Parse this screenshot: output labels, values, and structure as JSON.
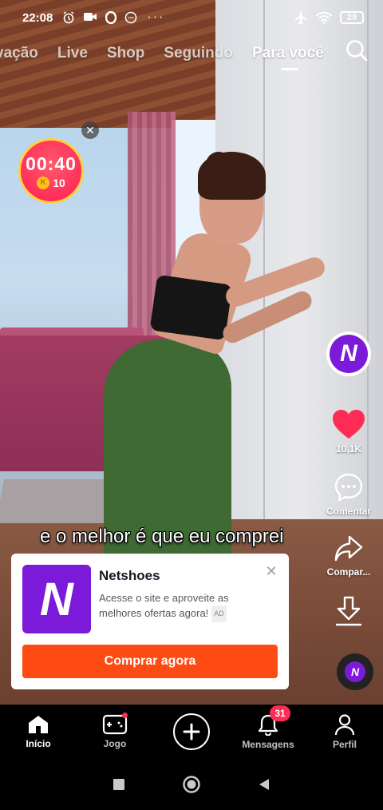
{
  "status_bar": {
    "time": "22:08",
    "battery": "29",
    "more": "···"
  },
  "top_tabs": [
    {
      "label": "vação",
      "active": false
    },
    {
      "label": "Live",
      "active": false
    },
    {
      "label": "Shop",
      "active": false
    },
    {
      "label": "Seguindo",
      "active": false
    },
    {
      "label": "Para você",
      "active": true
    }
  ],
  "timer": {
    "time": "00:40",
    "coins": "10",
    "coin_symbol": "K",
    "close": "✕"
  },
  "rail": {
    "creator_avatar": "N",
    "likes_count": "10,1K",
    "comment_label": "Comentar",
    "share_label": "Compar...",
    "sound_avatar": "N"
  },
  "caption": "e o melhor é que eu comprei",
  "ad": {
    "brand_logo": "N",
    "title": "Netshoes",
    "description": "Acesse o site e aproveite as melhores ofertas agora!",
    "badge": "AD",
    "cta": "Comprar agora",
    "close": "✕"
  },
  "bottom_nav": {
    "home": "Início",
    "game": "Jogo",
    "messages": "Mensagens",
    "messages_count": "31",
    "profile": "Perfil"
  },
  "colors": {
    "accent_red": "#fe2c55",
    "brand_purple": "#7b1bd9",
    "cta_orange": "#fe4a13",
    "like_red": "#fe2c55"
  }
}
